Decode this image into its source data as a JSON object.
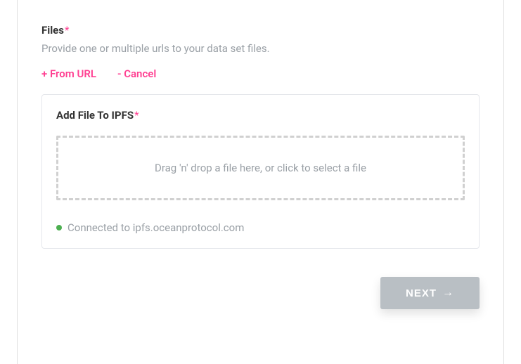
{
  "files": {
    "label": "Files",
    "required_marker": "*",
    "help": "Provide one or multiple urls to your data set files.",
    "actions": {
      "from_url": "+ From URL",
      "cancel": "- Cancel"
    }
  },
  "ipfs": {
    "title": "Add File To IPFS",
    "required_marker": "*",
    "dropzone_text": "Drag 'n' drop a file here, or click to select a file",
    "status_text": "Connected to ipfs.oceanprotocol.com"
  },
  "footer": {
    "next_label": "NEXT",
    "arrow": "→"
  }
}
